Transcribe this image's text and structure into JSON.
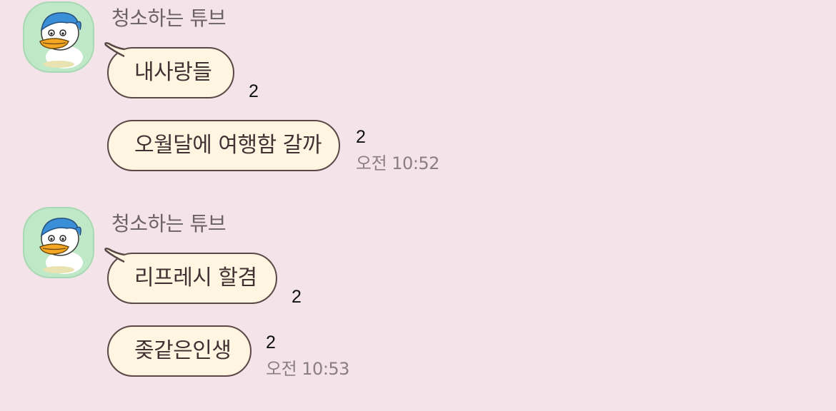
{
  "colors": {
    "background": "#f4e3e8",
    "bubble_fill": "#fff5e1",
    "bubble_border": "#5b4745",
    "avatar_bg": "#bfe8c9"
  },
  "groups": [
    {
      "sender": "청소하는 튜브",
      "avatar_icon": "tube-duck-avatar-icon",
      "messages": [
        {
          "text": "내사랑들",
          "unread": "2",
          "time": ""
        },
        {
          "text": "오월달에 여행함 갈까",
          "unread": "2",
          "time": "오전 10:52"
        }
      ]
    },
    {
      "sender": "청소하는 튜브",
      "avatar_icon": "tube-duck-avatar-icon",
      "messages": [
        {
          "text": "리프레시 할겸",
          "unread": "2",
          "time": ""
        },
        {
          "text": "좆같은인생",
          "unread": "2",
          "time": "오전 10:53"
        }
      ]
    }
  ]
}
